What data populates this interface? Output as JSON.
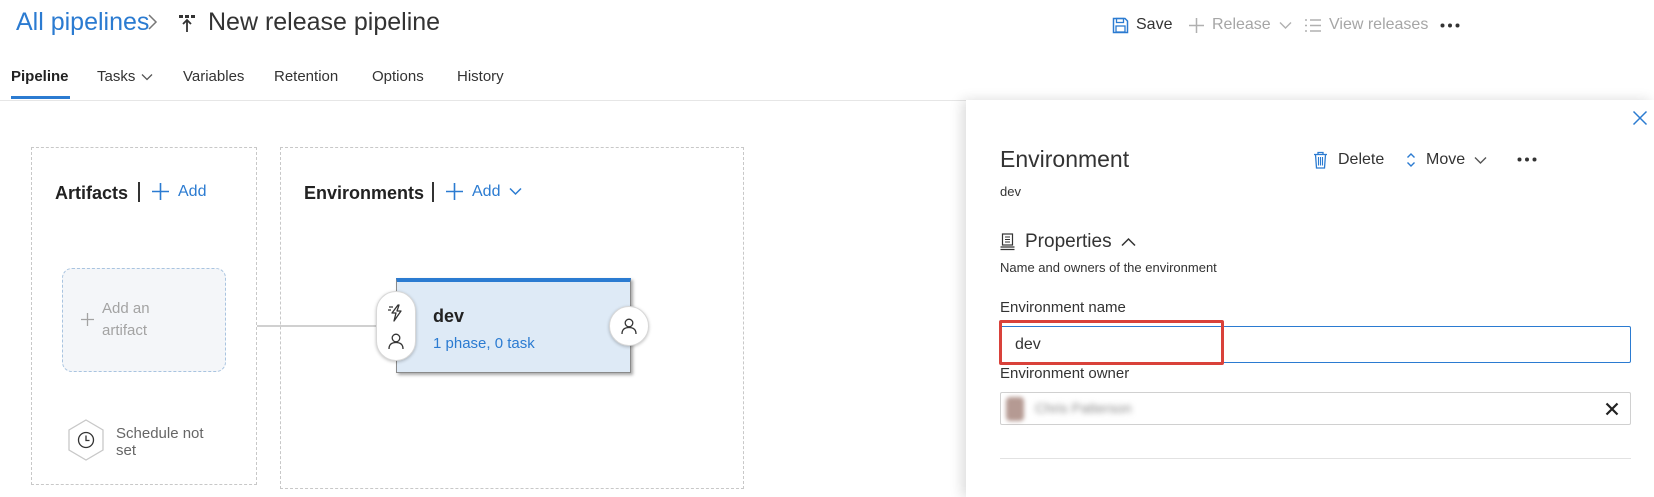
{
  "breadcrumb": {
    "root": "All pipelines",
    "title": "New release pipeline"
  },
  "toolbar": {
    "save": "Save",
    "release": "Release",
    "view_releases": "View releases"
  },
  "tabs": [
    {
      "label": "Pipeline",
      "active": true
    },
    {
      "label": "Tasks",
      "dropdown": true
    },
    {
      "label": "Variables"
    },
    {
      "label": "Retention"
    },
    {
      "label": "Options"
    },
    {
      "label": "History"
    }
  ],
  "artifacts": {
    "title": "Artifacts",
    "add": "Add",
    "placeholder_line1": "Add an",
    "placeholder_line2": "artifact",
    "schedule_line1": "Schedule not",
    "schedule_line2": "set"
  },
  "environments": {
    "title": "Environments",
    "add": "Add",
    "card": {
      "name": "dev",
      "summary": "1 phase, 0 task"
    }
  },
  "panel": {
    "title": "Environment",
    "subtitle": "dev",
    "delete": "Delete",
    "move": "Move",
    "section": "Properties",
    "section_desc": "Name and owners of the environment",
    "name_label": "Environment name",
    "name_value": "dev",
    "owner_label": "Environment owner",
    "owner_value": "Chris Patterson"
  },
  "colors": {
    "accent": "#2b7bd1",
    "highlight": "#d9413a",
    "card_bg": "#deeaf6"
  }
}
